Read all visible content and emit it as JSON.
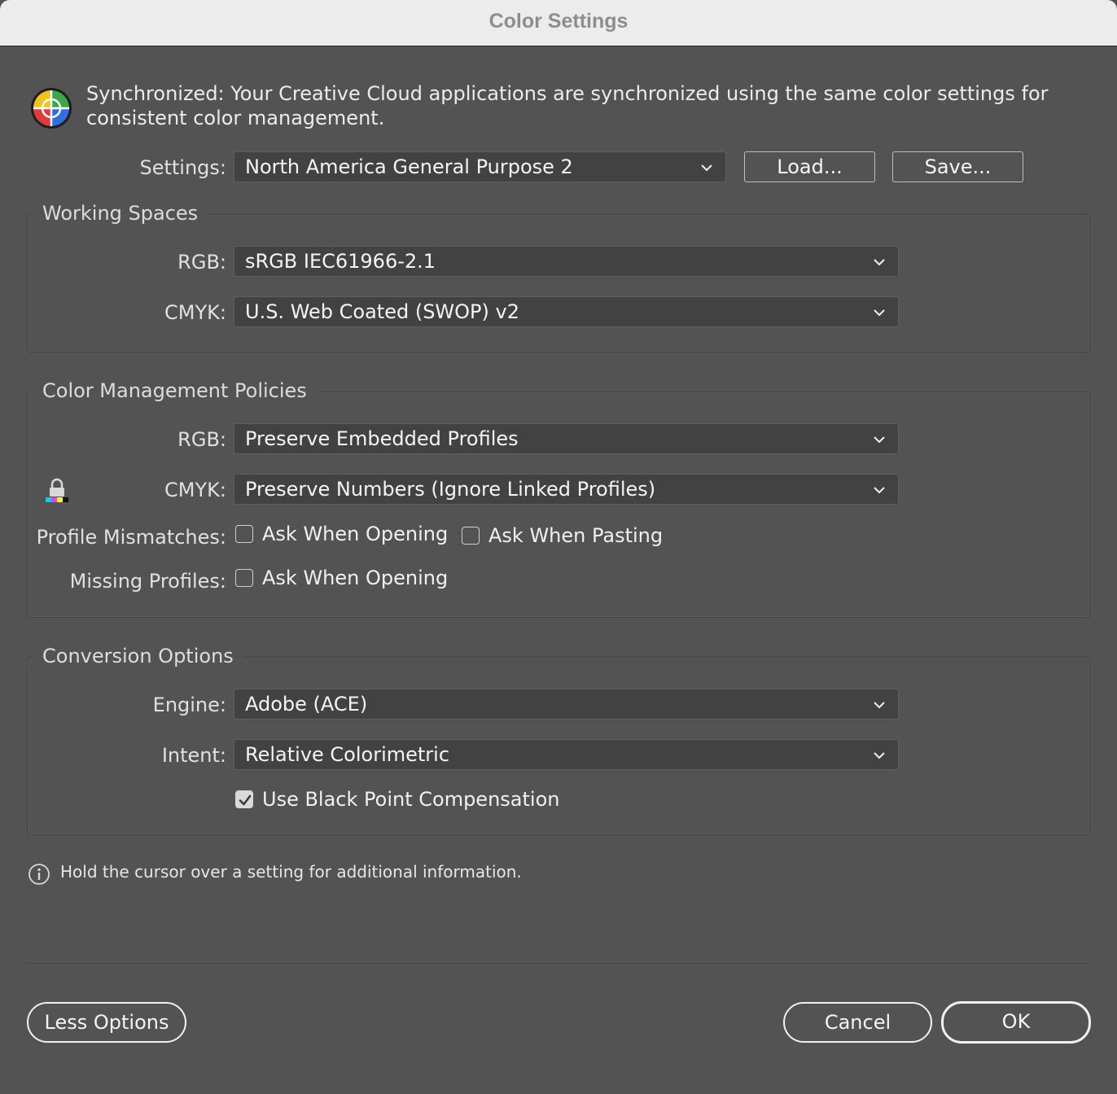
{
  "window": {
    "title": "Color Settings"
  },
  "sync": {
    "icon": "color-wheel-icon",
    "message": "Synchronized: Your Creative Cloud applications are synchronized using the same color settings for consistent color management."
  },
  "settings": {
    "label": "Settings:",
    "value": "North America General Purpose 2",
    "load_label": "Load...",
    "save_label": "Save..."
  },
  "working_spaces": {
    "title": "Working Spaces",
    "rgb_label": "RGB:",
    "rgb_value": "sRGB IEC61966-2.1",
    "cmyk_label": "CMYK:",
    "cmyk_value": "U.S. Web Coated (SWOP) v2"
  },
  "policies": {
    "title": "Color Management Policies",
    "rgb_label": "RGB:",
    "rgb_value": "Preserve Embedded Profiles",
    "cmyk_label": "CMYK:",
    "cmyk_value": "Preserve Numbers (Ignore Linked Profiles)",
    "mismatch_label": "Profile Mismatches:",
    "mismatch_open_label": "Ask When Opening",
    "mismatch_open_checked": false,
    "mismatch_paste_label": "Ask When Pasting",
    "mismatch_paste_checked": false,
    "missing_label": "Missing Profiles:",
    "missing_open_label": "Ask When Opening",
    "missing_open_checked": false
  },
  "conversion": {
    "title": "Conversion Options",
    "engine_label": "Engine:",
    "engine_value": "Adobe (ACE)",
    "intent_label": "Intent:",
    "intent_value": "Relative Colorimetric",
    "bpc_label": "Use Black Point Compensation",
    "bpc_checked": true
  },
  "info": {
    "icon": "info-icon",
    "text": "Hold the cursor over a setting for additional information."
  },
  "footer": {
    "less_options_label": "Less Options",
    "cancel_label": "Cancel",
    "ok_label": "OK"
  }
}
